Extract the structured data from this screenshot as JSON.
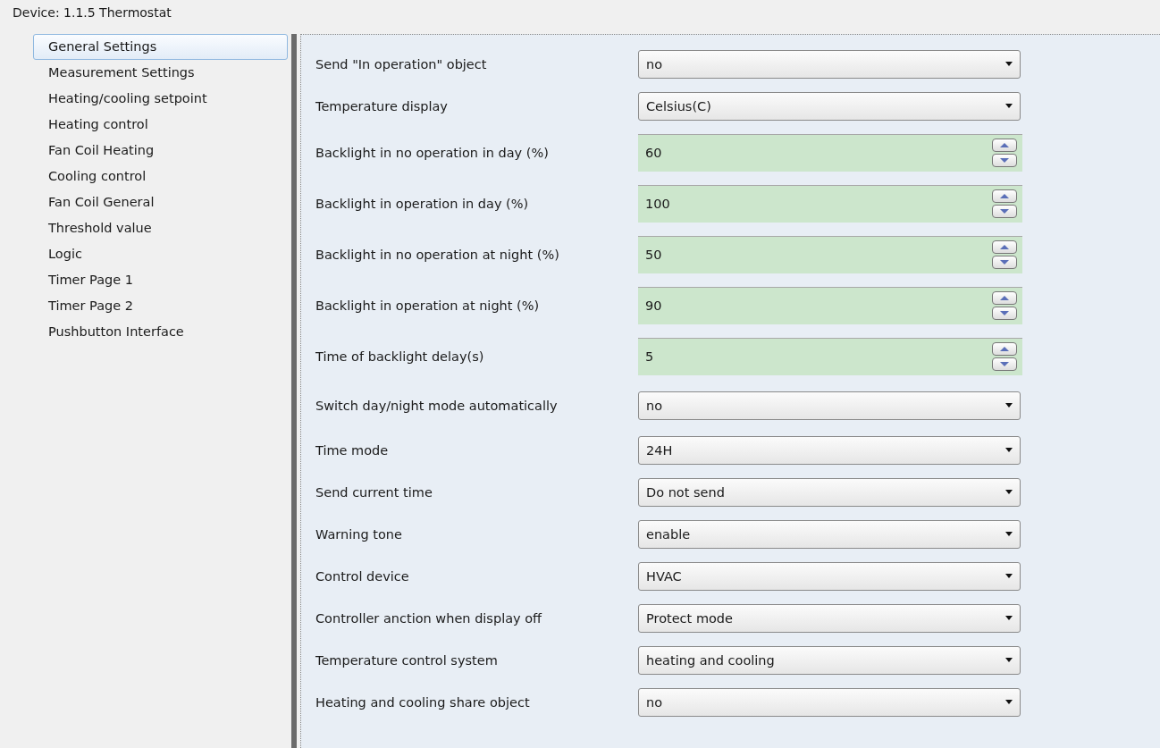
{
  "window": {
    "title": "Device: 1.1.5  Thermostat"
  },
  "sidebar": {
    "items": [
      {
        "label": "General Settings",
        "selected": true
      },
      {
        "label": "Measurement Settings",
        "selected": false
      },
      {
        "label": "Heating/cooling setpoint",
        "selected": false
      },
      {
        "label": "Heating control",
        "selected": false
      },
      {
        "label": "Fan Coil Heating",
        "selected": false
      },
      {
        "label": "Cooling control",
        "selected": false
      },
      {
        "label": "Fan Coil General",
        "selected": false
      },
      {
        "label": "Threshold value",
        "selected": false
      },
      {
        "label": "Logic",
        "selected": false
      },
      {
        "label": "Timer Page 1",
        "selected": false
      },
      {
        "label": "Timer Page 2",
        "selected": false
      },
      {
        "label": "Pushbutton Interface",
        "selected": false
      }
    ]
  },
  "parameters": [
    {
      "kind": "dropdown",
      "label": "Send \"In operation\" object",
      "value": "no"
    },
    {
      "kind": "dropdown",
      "label": "Temperature display",
      "value": "Celsius(C)"
    },
    {
      "kind": "spin",
      "label": "Backlight in no operation in day (%)",
      "value": "60"
    },
    {
      "kind": "spin",
      "label": "Backlight in operation in day (%)",
      "value": "100"
    },
    {
      "kind": "spin",
      "label": "Backlight in no operation at night (%)",
      "value": "50"
    },
    {
      "kind": "spin",
      "label": "Backlight in operation at night (%)",
      "value": "90"
    },
    {
      "kind": "spin",
      "label": "Time of backlight delay(s)",
      "value": "5"
    },
    {
      "kind": "dropdown",
      "label": "Switch day/night mode automatically",
      "value": "no"
    },
    {
      "kind": "dropdown",
      "label": "Time mode",
      "value": "24H"
    },
    {
      "kind": "dropdown",
      "label": "Send current time",
      "value": "Do not send"
    },
    {
      "kind": "dropdown",
      "label": "Warning tone",
      "value": "enable"
    },
    {
      "kind": "dropdown",
      "label": "Control device",
      "value": "HVAC"
    },
    {
      "kind": "dropdown",
      "label": "Controller anction when display off",
      "value": "Protect mode"
    },
    {
      "kind": "dropdown",
      "label": "Temperature control system",
      "value": "heating and cooling"
    },
    {
      "kind": "dropdown",
      "label": "Heating and cooling share object",
      "value": "no"
    }
  ]
}
